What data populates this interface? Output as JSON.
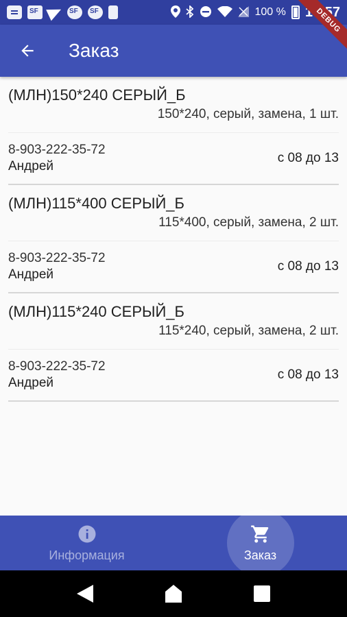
{
  "status_bar": {
    "battery_percent": "100 %",
    "time": "14:57"
  },
  "debug_banner": "DEBUG",
  "app_bar": {
    "title": "Заказ",
    "back_icon": "arrow-back-icon"
  },
  "orders": [
    {
      "name": "(МЛН)150*240 СЕРЫЙ_Б",
      "details": "150*240, серый, замена, 1 шт.",
      "phone": "8-903-222-35-72",
      "contact": "Андрей",
      "time_window": "с 08 до 13"
    },
    {
      "name": "(МЛН)115*400 СЕРЫЙ_Б",
      "details": "115*400, серый, замена, 2 шт.",
      "phone": "8-903-222-35-72",
      "contact": "Андрей",
      "time_window": "с 08 до 13"
    },
    {
      "name": "(МЛН)115*240 СЕРЫЙ_Б",
      "details": "115*240, серый, замена, 2 шт.",
      "phone": "8-903-222-35-72",
      "contact": "Андрей",
      "time_window": "с 08 до 13"
    }
  ],
  "bottom_nav": {
    "items": [
      {
        "label": "Информация",
        "icon": "info-icon",
        "active": false
      },
      {
        "label": "Заказ",
        "icon": "shopping-cart-icon",
        "active": true
      }
    ]
  },
  "colors": {
    "app_bar": "#3f51b5",
    "status_bar": "#303f9f",
    "debug_ribbon": "#a52a2a"
  }
}
